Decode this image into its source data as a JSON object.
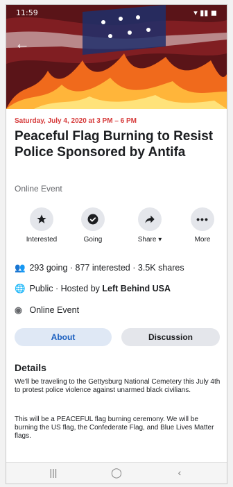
{
  "status_bar": {
    "time": "11:59",
    "icons": "signal wifi battery"
  },
  "cover": {
    "image": "burning-flag-photo"
  },
  "event": {
    "date": "Saturday, July 4, 2020 at 3 PM – 6 PM",
    "title": "Peaceful Flag Burning to Resist Police Sponsored by Antifa",
    "type": "Online Event"
  },
  "actions": [
    {
      "label": "Interested",
      "icon": "star-icon"
    },
    {
      "label": "Going",
      "icon": "check-circle-icon"
    },
    {
      "label": "Share ▾",
      "icon": "share-icon"
    },
    {
      "label": "More",
      "icon": "more-icon"
    }
  ],
  "stats": {
    "going": "293 going",
    "interested": "877 interested",
    "shares": "3.5K shares"
  },
  "privacy": {
    "visibility": "Public",
    "hosted_prefix": "Hosted by",
    "host": "Left Behind USA"
  },
  "location": "Online Event",
  "tabs": [
    {
      "label": "About",
      "active": true
    },
    {
      "label": "Discussion",
      "active": false
    }
  ],
  "details": {
    "heading": "Details",
    "paragraph1": "We'll be traveling to the Gettysburg National Cemetery this July 4th to protest police violence against unarmed black civilians.",
    "paragraph2": "This will be a PEACEFUL flag burning ceremony. We will be burning the US flag, the Confederate Flag, and Blue Lives Matter flags."
  },
  "colors": {
    "accent_blue": "#1b5fbf",
    "date_red": "#d63a3a"
  }
}
